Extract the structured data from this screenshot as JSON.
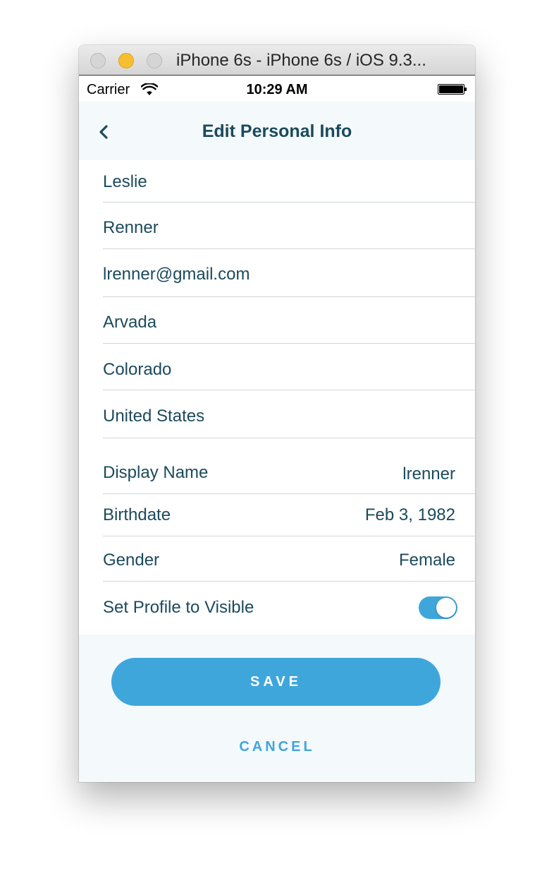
{
  "window": {
    "title": "iPhone 6s - iPhone 6s / iOS 9.3..."
  },
  "status_bar": {
    "carrier": "Carrier",
    "time": "10:29 AM"
  },
  "nav": {
    "title": "Edit Personal Info"
  },
  "fields": {
    "first_name": "Leslie",
    "last_name": "Renner",
    "email": "lrenner@gmail.com",
    "city": "Arvada",
    "state": "Colorado",
    "country": "United States"
  },
  "settings": {
    "display_name": {
      "label": "Display Name",
      "value": "lrenner"
    },
    "birthdate": {
      "label": "Birthdate",
      "value": "Feb 3, 1982"
    },
    "gender": {
      "label": "Gender",
      "value": "Female"
    },
    "visibility": {
      "label": "Set Profile to Visible",
      "on": true
    }
  },
  "actions": {
    "save": "SAVE",
    "cancel": "CANCEL"
  },
  "colors": {
    "accent": "#3fa6dc",
    "text": "#1b4a5c",
    "background": "#f4f9fb"
  }
}
